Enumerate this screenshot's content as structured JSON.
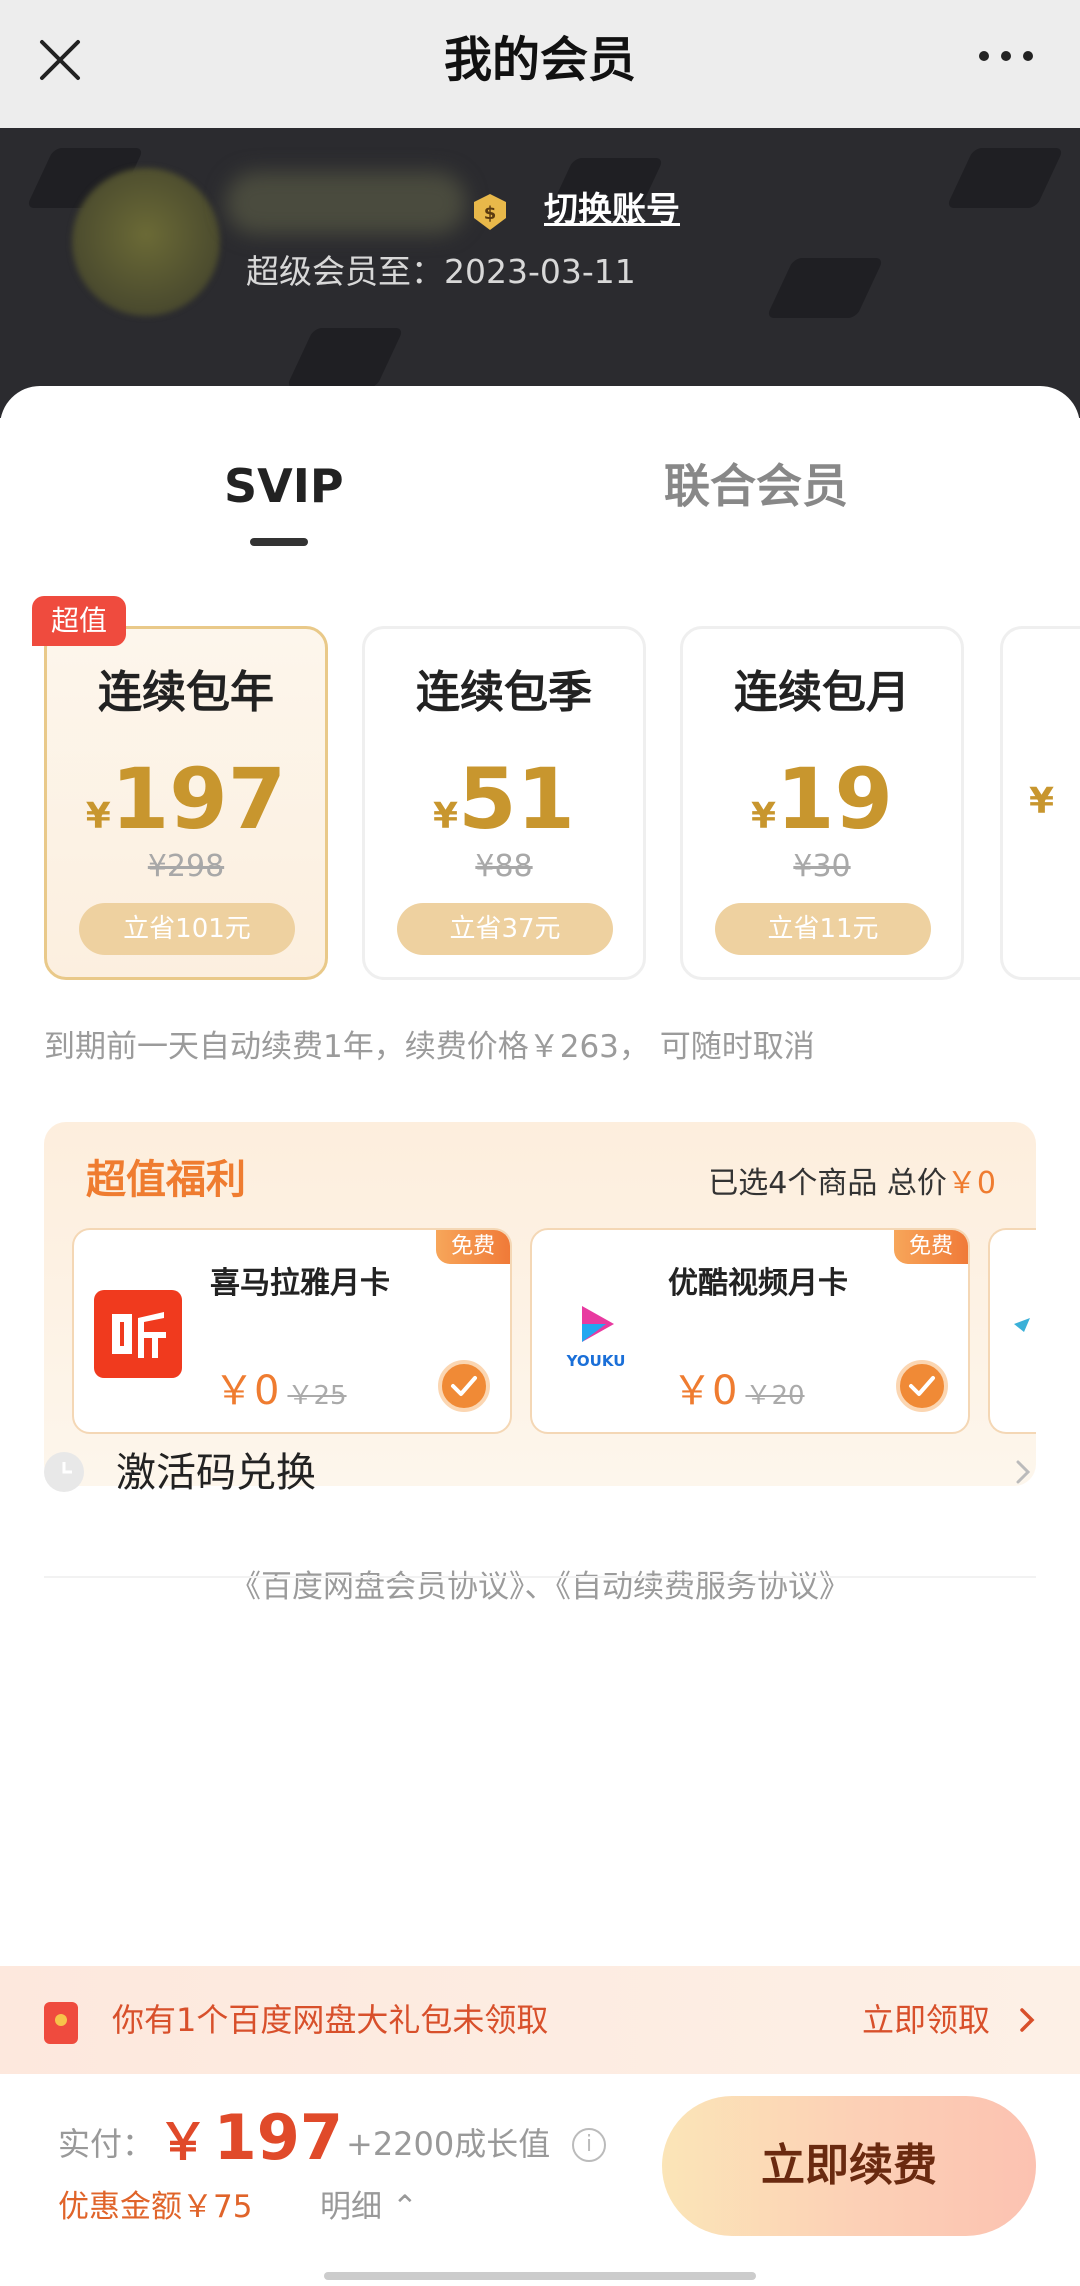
{
  "nav": {
    "title": "我的会员",
    "close_icon": "close-icon",
    "more_icon": "more-icon"
  },
  "profile": {
    "switch_account": "切换账号",
    "expire_text": "超级会员至：2023-03-11"
  },
  "tabs": [
    {
      "label": "SVIP",
      "active": true
    },
    {
      "label": "联合会员",
      "active": false
    }
  ],
  "plans": [
    {
      "name": "连续包年",
      "currency": "¥",
      "price": "197",
      "original": "¥298",
      "save": "立省101元",
      "tag": "超值",
      "selected": true
    },
    {
      "name": "连续包季",
      "currency": "¥",
      "price": "51",
      "original": "¥88",
      "save": "立省37元",
      "selected": false
    },
    {
      "name": "连续包月",
      "currency": "¥",
      "price": "19",
      "original": "¥30",
      "save": "立省11元",
      "selected": false
    }
  ],
  "renew_note": "到期前一天自动续费1年，续费价格￥263， 可随时取消",
  "benefits": {
    "title": "超值福利",
    "summary_prefix": "已选4个商品 总价",
    "summary_total": "￥0",
    "items": [
      {
        "name": "喜马拉雅月卡",
        "tag": "免费",
        "price": "￥0",
        "original": "￥25",
        "checked": true,
        "icon": "ximalaya-logo-icon"
      },
      {
        "name": "优酷视频月卡",
        "tag": "免费",
        "price": "￥0",
        "original": "￥20",
        "checked": true,
        "icon": "youku-logo-icon"
      }
    ]
  },
  "agreements": "《百度网盘会员协议》、《自动续费服务协议》",
  "activation": {
    "label": "激活码兑换"
  },
  "gift": {
    "text": "你有1个百度网盘大礼包未领取",
    "action": "立即领取"
  },
  "bottom": {
    "pay_label": "实付：",
    "currency": "￥",
    "amount": "197",
    "growth": "+2200成长值",
    "discount": "优惠金额￥75",
    "detail": "明细 ⌃",
    "button": "立即续费"
  },
  "colors": {
    "accent_gold": "#c8962e",
    "accent_orange": "#ef7c30",
    "price_red": "#e04a2a",
    "tag_red": "#ef4b3e"
  }
}
